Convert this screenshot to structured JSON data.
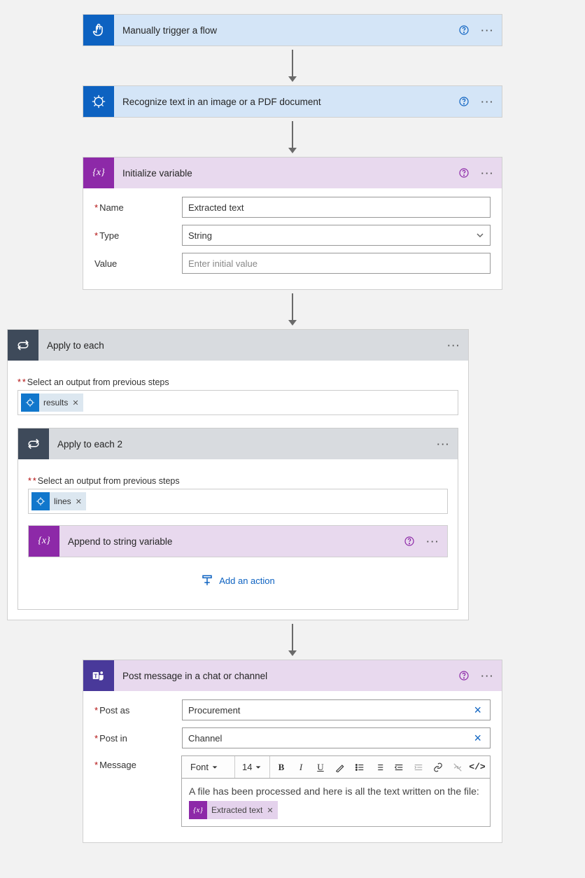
{
  "steps": {
    "trigger": {
      "title": "Manually trigger a flow"
    },
    "recognize": {
      "title": "Recognize text in an image or a PDF document"
    },
    "initvar": {
      "title": "Initialize variable",
      "name_label": "Name",
      "name_value": "Extracted text",
      "type_label": "Type",
      "type_value": "String",
      "value_label": "Value",
      "value_placeholder": "Enter initial value"
    },
    "apply1": {
      "title": "Apply to each",
      "select_label": "Select an output from previous steps",
      "token": "results"
    },
    "apply2": {
      "title": "Apply to each 2",
      "select_label": "Select an output from previous steps",
      "token": "lines"
    },
    "append": {
      "title": "Append to string variable"
    },
    "add_action": "Add an action",
    "post": {
      "title": "Post message in a chat or channel",
      "postas_label": "Post as",
      "postas_value": "Procurement",
      "postin_label": "Post in",
      "postin_value": "Channel",
      "message_label": "Message",
      "font_label": "Font",
      "size_label": "14",
      "message_text": "A file has been processed and here is all the text written on the file:",
      "token": "Extracted text"
    }
  }
}
